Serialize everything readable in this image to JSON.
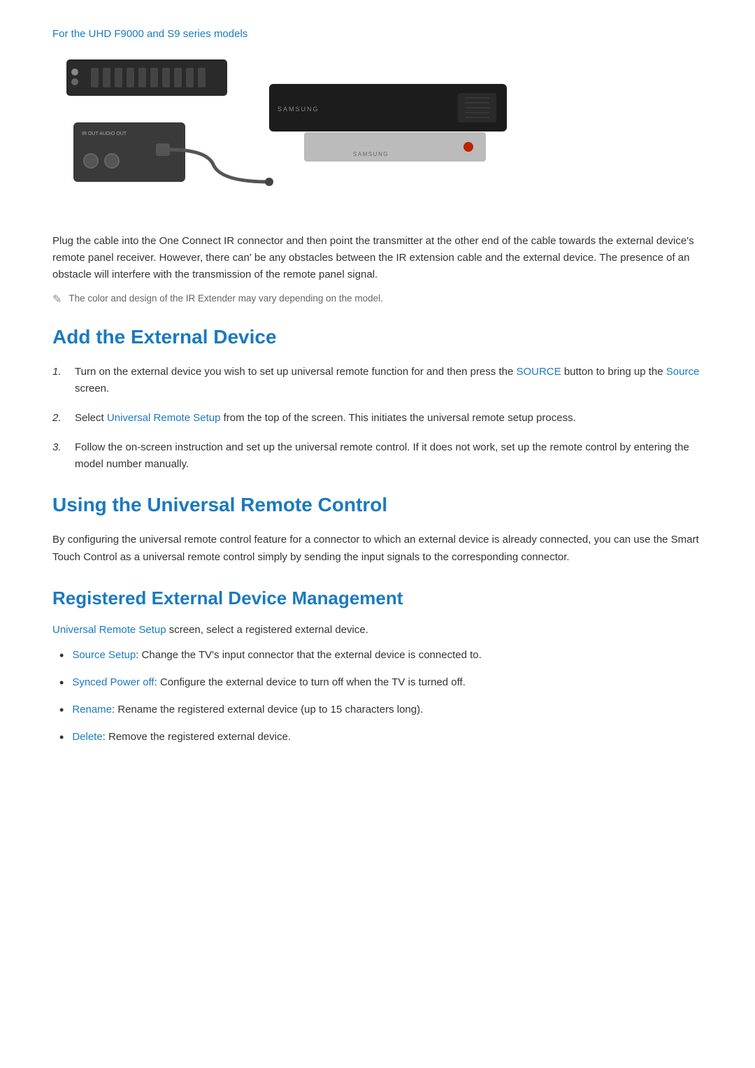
{
  "page": {
    "section_label": "For the UHD F9000 and S9 series models",
    "body_text_1": "Plug the cable into the One Connect IR connector and then point the transmitter at the other end of the cable towards the external device's remote panel receiver. However, there can' be any obstacles between the IR extension cable and the external device. The presence of an obstacle will interfere with the transmission of the remote panel signal.",
    "note_text": "The color and design of the IR Extender may vary depending on the model.",
    "add_device": {
      "heading": "Add the External Device",
      "steps": [
        {
          "num": "1.",
          "before": "Turn on the external device you wish to set up universal remote function for and then press the ",
          "link1": "SOURCE",
          "middle": " button to bring up the ",
          "link2": "Source",
          "after": " screen."
        },
        {
          "num": "2.",
          "before": "Select ",
          "link1": "Universal Remote Setup",
          "after": " from the top of the screen. This initiates the universal remote setup process."
        },
        {
          "num": "3.",
          "text": "Follow the on-screen instruction and set up the universal remote control. If it does not work, set up the remote control by entering the model number manually."
        }
      ]
    },
    "universal_remote": {
      "heading": "Using the Universal Remote Control",
      "body": "By configuring the universal remote control feature for a connector to which an external device is already connected, you can use the Smart Touch Control as a universal remote control simply by sending the input signals to the corresponding connector."
    },
    "registered_device": {
      "heading": "Registered External Device Management",
      "intro_link": "Universal Remote Setup",
      "intro_after": " screen, select a registered external device.",
      "items": [
        {
          "link": "Source Setup",
          "text": ": Change the TV's input connector that the external device is connected to."
        },
        {
          "link": "Synced Power off",
          "text": ": Configure the external device to turn off when the TV is turned off."
        },
        {
          "link": "Rename",
          "text": ": Rename the registered external device (up to 15 characters long)."
        },
        {
          "link": "Delete",
          "text": ": Remove the registered external device."
        }
      ]
    }
  }
}
